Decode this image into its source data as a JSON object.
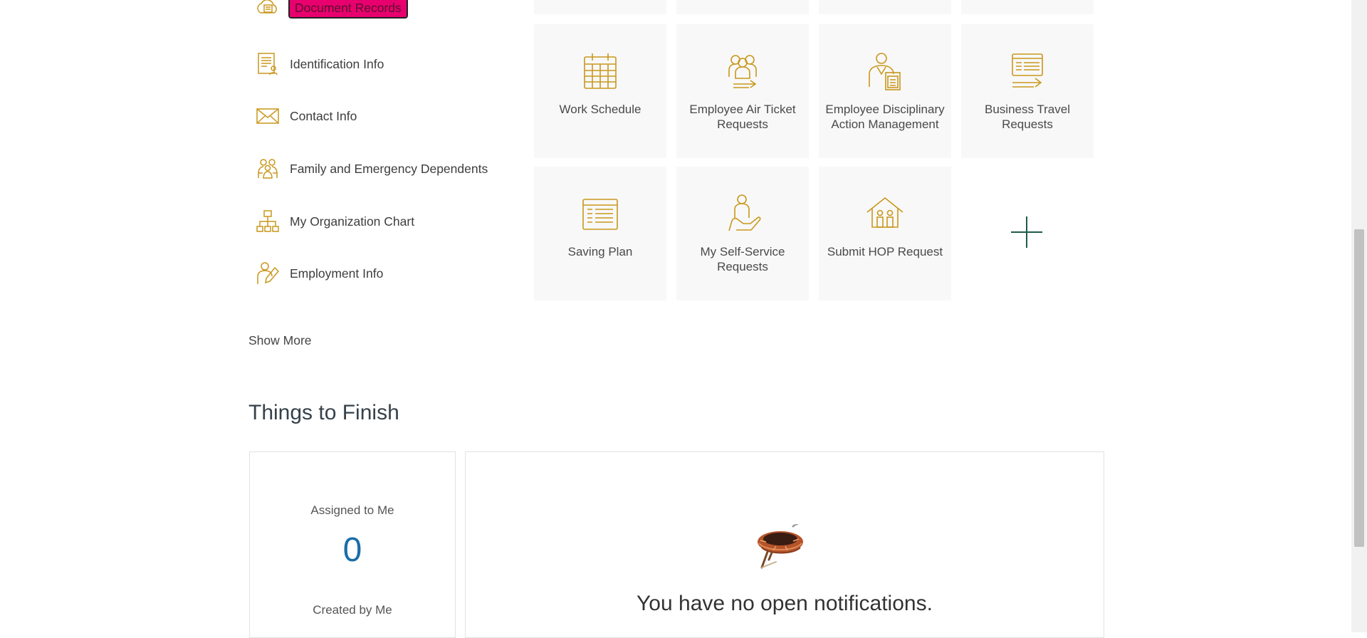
{
  "quick_links": [
    {
      "label": "Document Records",
      "icon": "cloud-document-icon",
      "highlighted": true
    },
    {
      "label": "Identification Info",
      "icon": "id-card-icon"
    },
    {
      "label": "Contact Info",
      "icon": "envelope-icon"
    },
    {
      "label": "Family and Emergency Dependents",
      "icon": "family-icon"
    },
    {
      "label": "My Organization Chart",
      "icon": "org-chart-icon"
    },
    {
      "label": "Employment Info",
      "icon": "employment-icon"
    }
  ],
  "show_more": "Show More",
  "tiles": [
    {
      "label": "Work Schedule",
      "icon": "calendar-icon"
    },
    {
      "label": "Employee Air Ticket Requests",
      "icon": "group-arrow-icon"
    },
    {
      "label": "Employee Disciplinary Action Management",
      "icon": "person-document-icon"
    },
    {
      "label": "Business Travel Requests",
      "icon": "list-arrow-icon"
    },
    {
      "label": "Saving Plan",
      "icon": "ledger-icon"
    },
    {
      "label": "My Self-Service Requests",
      "icon": "hand-person-icon"
    },
    {
      "label": "Submit HOP Request",
      "icon": "house-family-icon"
    }
  ],
  "things_to_finish": {
    "title": "Things to Finish",
    "assigned_label": "Assigned to Me",
    "assigned_count": "0",
    "created_label": "Created by Me",
    "empty_message": "You have no open notifications."
  },
  "colors": {
    "icon_gold": "#c9971c",
    "accent_green": "#1f5a4b",
    "count_blue": "#1a6ea8",
    "highlight": "#e8006f"
  }
}
